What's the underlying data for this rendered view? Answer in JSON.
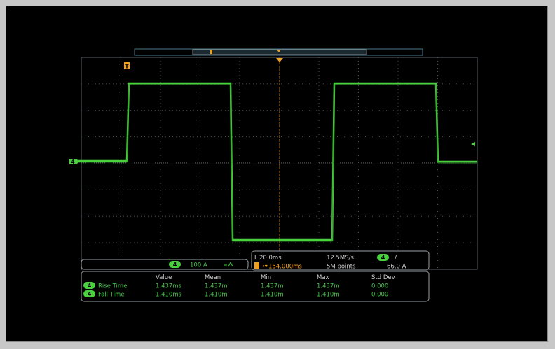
{
  "colors": {
    "background": "#000000",
    "frame": "#c7c7c7",
    "grid": "#3a3f44",
    "waveform": "#49d23d",
    "accent_orange": "#f0a020",
    "box_border": "#9aa0a6",
    "text_gray": "#cfcfcf",
    "text_green": "#47c84a"
  },
  "channel": {
    "number": "4",
    "scale": "100 A",
    "coupling_icon": "dc-coupling-icon"
  },
  "markers": {
    "trigger_marker": "T",
    "record_marker": "B"
  },
  "horizontal": {
    "time_per_div": "20.0ms",
    "sample_rate": "12.5MS/s",
    "delay": "154.000ms",
    "record_length": "5M points"
  },
  "trigger": {
    "source": "4",
    "slope": "/",
    "level": "66.0 A"
  },
  "measurements": {
    "headers": [
      "Value",
      "Mean",
      "Min",
      "Max",
      "Std Dev"
    ],
    "rows": [
      {
        "ch": "4",
        "name": "Rise Time",
        "value": "1.437ms",
        "mean": "1.437m",
        "min": "1.437m",
        "max": "1.437m",
        "std": "0.000"
      },
      {
        "ch": "4",
        "name": "Fall Time",
        "value": "1.410ms",
        "mean": "1.410m",
        "min": "1.410m",
        "max": "1.410m",
        "std": "0.000"
      }
    ]
  }
}
